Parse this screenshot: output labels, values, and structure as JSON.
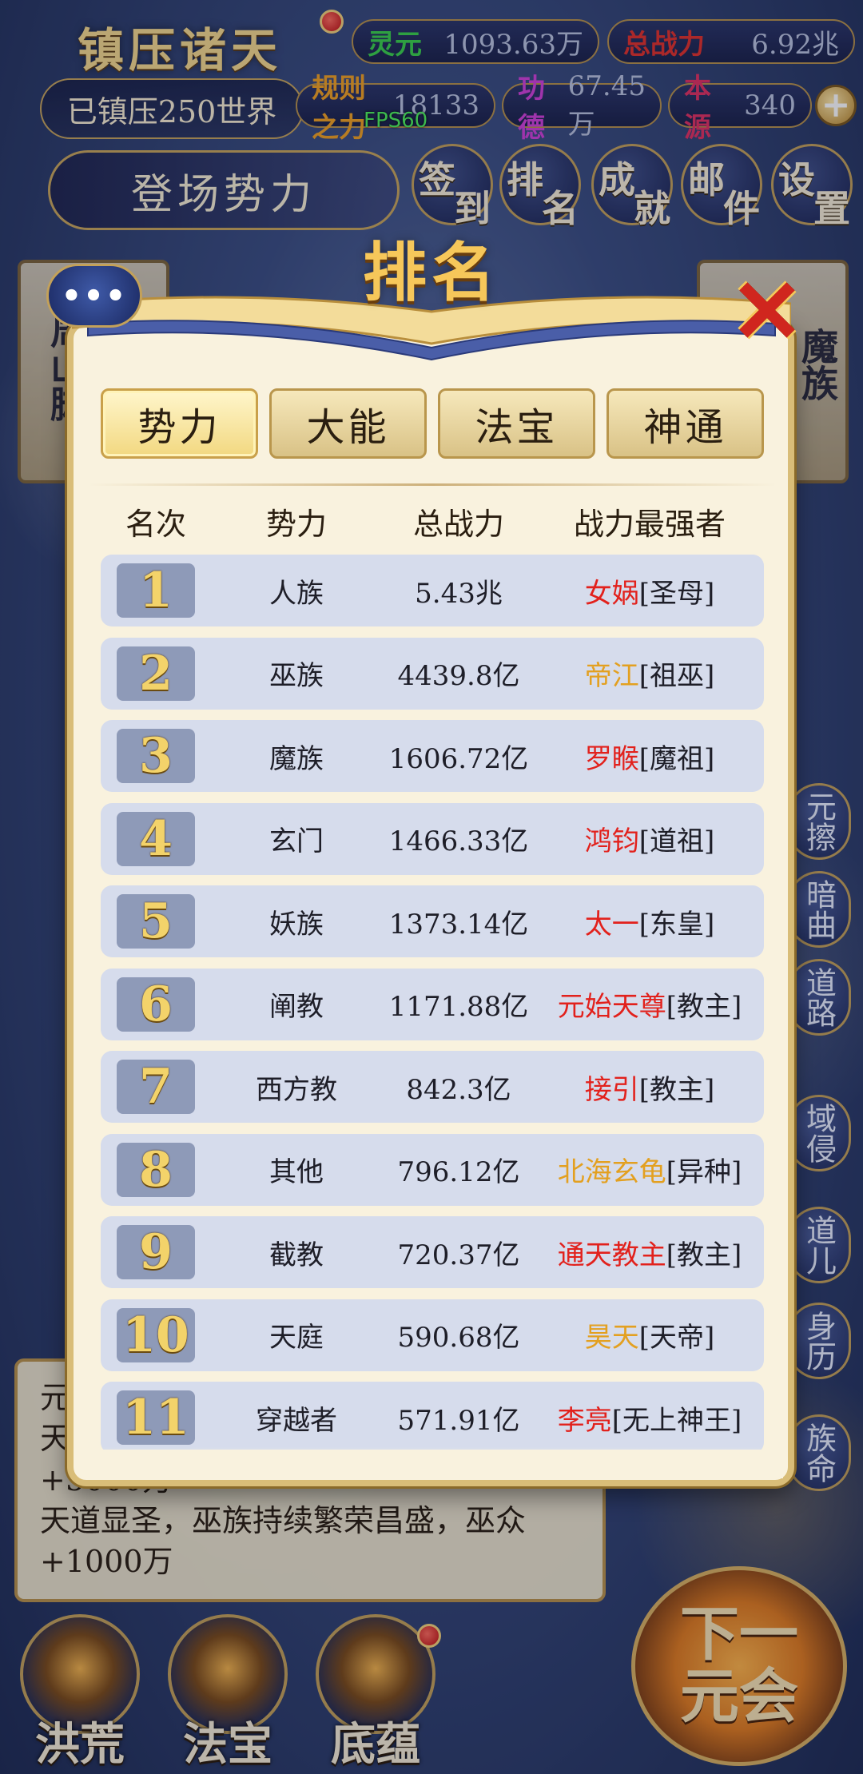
{
  "hud": {
    "title": "镇压诸天",
    "suppressed": "已镇压250世界",
    "resources": [
      {
        "label": "灵元",
        "value": "1093.63万",
        "color": "#3ad04a"
      },
      {
        "label": "总战力",
        "value": "6.92兆",
        "color": "#e0302a"
      },
      {
        "label": "规则之力",
        "value": "18133",
        "color": "#f0a020"
      },
      {
        "label": "功德",
        "value": "67.45万",
        "color": "#d040d8"
      },
      {
        "label": "本源",
        "value": "340",
        "color": "#e03060"
      }
    ],
    "plus": "+",
    "fps": "FPS60",
    "faction_banner": "登场势力"
  },
  "menu": [
    {
      "c1": "签",
      "c2": "到"
    },
    {
      "c1": "排",
      "c2": "名"
    },
    {
      "c1": "成",
      "c2": "就"
    },
    {
      "c1": "邮",
      "c2": "件"
    },
    {
      "c1": "设",
      "c2": "置"
    }
  ],
  "background_cards": {
    "left": "周山脚",
    "right": "魔族"
  },
  "chat_bubble": "•••",
  "side_buttons": [
    "元擦",
    "暗曲",
    "道路",
    "域侵",
    "道儿",
    "身历",
    "族命"
  ],
  "log": {
    "lines": [
      "元",
      "天",
      "+5000万",
      "天道显圣，巫族持续繁荣昌盛，巫众",
      "+1000万"
    ]
  },
  "bottom_nav": [
    "洪荒",
    "法宝",
    "底蕴"
  ],
  "next_era": {
    "line1": "下一",
    "line2": "元会"
  },
  "modal": {
    "title": "排名",
    "close": "✕",
    "tabs": [
      "势力",
      "大能",
      "法宝",
      "神通"
    ],
    "active_tab": 0,
    "headers": {
      "rank": "名次",
      "force": "势力",
      "power": "总战力",
      "strongest": "战力最强者"
    },
    "rows": [
      {
        "rank": "1",
        "force": "人族",
        "power": "5.43兆",
        "name": "女娲",
        "title": "[圣母]",
        "name_color": "red"
      },
      {
        "rank": "2",
        "force": "巫族",
        "power": "4439.8亿",
        "name": "帝江",
        "title": "[祖巫]",
        "name_color": "gold"
      },
      {
        "rank": "3",
        "force": "魔族",
        "power": "1606.72亿",
        "name": "罗睺",
        "title": "[魔祖]",
        "name_color": "red"
      },
      {
        "rank": "4",
        "force": "玄门",
        "power": "1466.33亿",
        "name": "鸿钧",
        "title": "[道祖]",
        "name_color": "red"
      },
      {
        "rank": "5",
        "force": "妖族",
        "power": "1373.14亿",
        "name": "太一",
        "title": "[东皇]",
        "name_color": "red"
      },
      {
        "rank": "6",
        "force": "阐教",
        "power": "1171.88亿",
        "name": "元始天尊",
        "title": "[教主]",
        "name_color": "red"
      },
      {
        "rank": "7",
        "force": "西方教",
        "power": "842.3亿",
        "name": "接引",
        "title": "[教主]",
        "name_color": "red"
      },
      {
        "rank": "8",
        "force": "其他",
        "power": "796.12亿",
        "name": "北海玄龟",
        "title": "[异种]",
        "name_color": "gold"
      },
      {
        "rank": "9",
        "force": "截教",
        "power": "720.37亿",
        "name": "通天教主",
        "title": "[教主]",
        "name_color": "red"
      },
      {
        "rank": "10",
        "force": "天庭",
        "power": "590.68亿",
        "name": "昊天",
        "title": "[天帝]",
        "name_color": "gold"
      },
      {
        "rank": "11",
        "force": "穿越者",
        "power": "571.91亿",
        "name": "李亮",
        "title": "[无上神王]",
        "name_color": "red"
      }
    ]
  }
}
